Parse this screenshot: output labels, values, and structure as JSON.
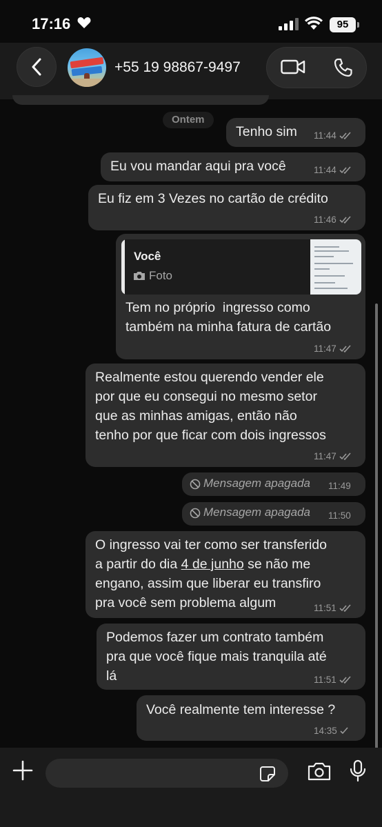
{
  "status_bar": {
    "time": "17:16",
    "battery": "95"
  },
  "header": {
    "contact": "+55 19 98867-9497"
  },
  "chat": {
    "date_separator": "Ontem",
    "messages": [
      {
        "text": "Tenho sim",
        "time": "11:44",
        "read": "double-check"
      },
      {
        "text": "Eu vou mandar aqui pra você",
        "time": "11:44",
        "read": "double-check"
      },
      {
        "text": "Eu fiz em 3 Vezes no cartão de crédito",
        "time": "11:46",
        "read": "double-check"
      },
      {
        "quote_author": "Você",
        "quote_type": "Foto",
        "text_line1": "Tem no próprio  ingresso como",
        "text_line2": "também na minha fatura de cartão",
        "time": "11:47",
        "read": "double-check"
      },
      {
        "text": "Realmente estou querendo vender ele\npor que eu consegui no mesmo setor\nque as minhas amigas, então não\ntenho por que ficar com dois ingressos",
        "time": "11:47",
        "read": "double-check"
      },
      {
        "deleted_text": "Mensagem apagada",
        "time": "11:49"
      },
      {
        "deleted_text": "Mensagem apagada",
        "time": "11:50"
      },
      {
        "line1": "O ingresso vai ter como ser transferido",
        "line2_pre": "a partir do dia ",
        "line2_link": "4 de junho",
        "line2_post": " se não me",
        "line3": "engano, assim que liberar eu transfiro",
        "line4": "pra você sem problema algum",
        "time": "11:51",
        "read": "double-check"
      },
      {
        "text": "Podemos fazer um contrato também\npra que você fique mais tranquila até\nlá",
        "time": "11:51",
        "read": "double-check"
      },
      {
        "text": "Você realmente tem interesse ?",
        "time": "14:35",
        "read": "single-check"
      }
    ]
  },
  "icons": {
    "back": "chevron-left-icon",
    "video": "video-camera-icon",
    "phone": "phone-icon",
    "plus": "plus-icon",
    "sticker": "sticker-icon",
    "camera": "camera-icon",
    "mic": "microphone-icon"
  }
}
